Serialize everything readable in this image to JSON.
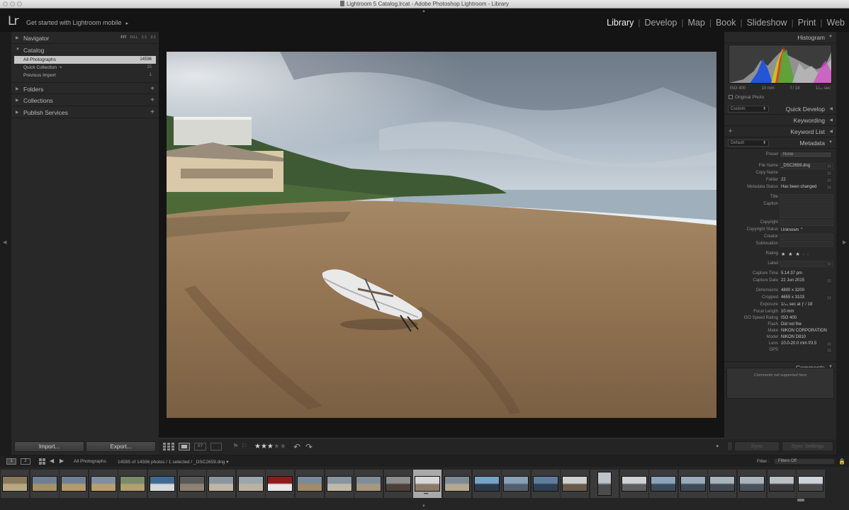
{
  "window": {
    "title": "Lightroom 5 Catalog.lrcat - Adobe Photoshop Lightroom - Library"
  },
  "identity": {
    "logo": "Lr",
    "mobile_text": "Get started with Lightroom mobile",
    "mobile_arrow": "▸"
  },
  "modules": [
    {
      "label": "Library",
      "active": true
    },
    {
      "label": "Develop"
    },
    {
      "label": "Map"
    },
    {
      "label": "Book"
    },
    {
      "label": "Slideshow"
    },
    {
      "label": "Print"
    },
    {
      "label": "Web"
    }
  ],
  "left_panel": {
    "navigator": {
      "title": "Navigator",
      "modes": [
        "FIT",
        "FILL",
        "1:1",
        "3:1"
      ]
    },
    "catalog": {
      "title": "Catalog",
      "items": [
        {
          "label": "All Photographs",
          "count": "14596",
          "selected": true
        },
        {
          "label": "Quick Collection",
          "suffix": "+",
          "count": "15"
        },
        {
          "label": "Previous Import",
          "count": "1"
        }
      ]
    },
    "sections": [
      {
        "title": "Folders",
        "plus": "+"
      },
      {
        "title": "Collections",
        "plus": "+"
      },
      {
        "title": "Publish Services",
        "plus": "+"
      }
    ],
    "buttons": {
      "import": "Import...",
      "export": "Export..."
    }
  },
  "toolbar": {
    "compare_label": "XY",
    "stars_on": "★★★",
    "stars_off": "★★",
    "rotate_left": "↶",
    "rotate_right": "↷",
    "dropdown": "▾"
  },
  "right_panel": {
    "histogram": {
      "title": "Histogram",
      "iso": "ISO 400",
      "focal": "10 mm",
      "aperture": "f / 18",
      "shutter": "1/₄₀ sec",
      "original_photo": "Original Photo"
    },
    "quick_develop": {
      "title": "Quick Develop",
      "preset": "Custom"
    },
    "keywording": {
      "title": "Keywording"
    },
    "keyword_list": {
      "title": "Keyword List",
      "plus": "+"
    },
    "metadata": {
      "title": "Metadata",
      "preset_dd": "Default",
      "preset_label": "Preset",
      "preset_value": "None",
      "rows": [
        {
          "key": "File Name",
          "value": "_DSC2659.dng"
        },
        {
          "key": "Copy Name",
          "value": ""
        },
        {
          "key": "Folder",
          "value": "22"
        },
        {
          "key": "Metadata Status",
          "value": "Has been changed"
        },
        {
          "key": "Title",
          "value": ""
        },
        {
          "key": "Caption",
          "value": ""
        },
        {
          "key": "Copyright",
          "value": ""
        },
        {
          "key": "Copyright Status",
          "value": "Unknown ⌃"
        },
        {
          "key": "Creator",
          "value": ""
        },
        {
          "key": "Sublocation",
          "value": ""
        },
        {
          "key": "Rating",
          "value": "★ ★ ★ ·  ·"
        },
        {
          "key": "Label",
          "value": ""
        },
        {
          "key": "Capture Time",
          "value": "5:14:37 pm"
        },
        {
          "key": "Capture Date",
          "value": "22 Jun 2015"
        },
        {
          "key": "Dimensions",
          "value": "4800 x 3200"
        },
        {
          "key": "Cropped",
          "value": "4655 x 3103"
        },
        {
          "key": "Exposure",
          "value": "1/₄₀ sec at ƒ / 18"
        },
        {
          "key": "Focal Length",
          "value": "10 mm"
        },
        {
          "key": "ISO Speed Rating",
          "value": "ISO 400"
        },
        {
          "key": "Flash",
          "value": "Did not fire"
        },
        {
          "key": "Make",
          "value": "NIKON CORPORATION"
        },
        {
          "key": "Model",
          "value": "NIKON D810"
        },
        {
          "key": "Lens",
          "value": "10.0-20.0 mm f/3.5"
        },
        {
          "key": "GPS",
          "value": ""
        }
      ]
    },
    "comments": {
      "title": "Comments",
      "placeholder": "Comments not supported here"
    },
    "sync": {
      "sync": "Sync",
      "sync_settings": "Sync Settings"
    }
  },
  "filmstrip": {
    "page1": "1",
    "page2": "2",
    "source": "All Photographs",
    "status": "14595 of 14596 photos / 1 selected / _DSC2659.dng ▾",
    "filter_label": "Filter :",
    "filter_value": "Filters Off"
  }
}
